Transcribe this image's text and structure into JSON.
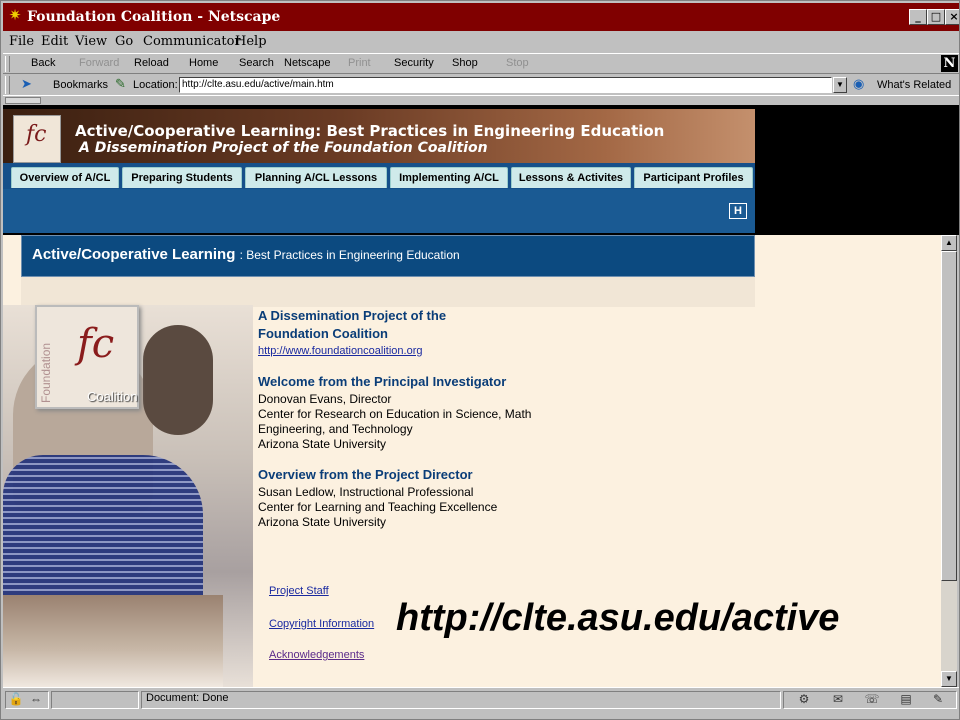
{
  "window": {
    "title": "Foundation Coalition - Netscape",
    "controls": [
      "_",
      "□",
      "×"
    ]
  },
  "menu": [
    "File",
    "Edit",
    "View",
    "Go",
    "Communicator",
    "Help"
  ],
  "toolbar": {
    "buttons": [
      {
        "label": "Back",
        "enabled": true
      },
      {
        "label": "Forward",
        "enabled": false
      },
      {
        "label": "Reload",
        "enabled": true
      },
      {
        "label": "Home",
        "enabled": true
      },
      {
        "label": "Search",
        "enabled": true
      },
      {
        "label": "Netscape",
        "enabled": true
      },
      {
        "label": "Print",
        "enabled": false
      },
      {
        "label": "Security",
        "enabled": true
      },
      {
        "label": "Shop",
        "enabled": true
      },
      {
        "label": "Stop",
        "enabled": false
      }
    ],
    "logo": "N"
  },
  "location": {
    "bookmarks_label": "Bookmarks",
    "location_label": "Location:",
    "url": "http://clte.asu.edu/active/main.htm",
    "whats_related": "What's Related"
  },
  "page": {
    "banner_title": "Active/Cooperative Learning:  Best Practices in Engineering Education",
    "banner_subtitle": "A Dissemination Project of the Foundation Coalition",
    "logo_text": "fc",
    "tabs": [
      "Overview of A/CL",
      "Preparing Students",
      "Planning A/CL Lessons",
      "Implementing A/CL",
      "Lessons & Activites",
      "Participant Profiles"
    ],
    "home_icon": "H",
    "title_main": "Active/Cooperative Learning",
    "title_sub": ": Best Practices in Engineering Education",
    "fc_logo": {
      "mark": "fc",
      "word1": "Foundation",
      "word2": "Coalition"
    },
    "sections": {
      "dissemination_heading_1": "A Dissemination Project of the",
      "dissemination_heading_2": "Foundation Coalition",
      "dissemination_link": "http://www.foundationcoalition.org",
      "welcome_heading": "Welcome from the Principal Investigator",
      "welcome_lines": [
        "Donovan Evans, Director",
        "Center for Research on Education in Science, Math",
        "Engineering, and Technology",
        "Arizona State University"
      ],
      "overview_heading": "Overview from the Project Director",
      "overview_lines": [
        "Susan Ledlow, Instructional Professional",
        "Center for Learning and Teaching Excellence",
        "Arizona State University"
      ]
    },
    "bottom_links": [
      "Project Staff",
      "Copyright Information",
      "Acknowledgements"
    ],
    "big_url": "http://clte.asu.edu/active"
  },
  "status": {
    "text": "Document: Done"
  }
}
